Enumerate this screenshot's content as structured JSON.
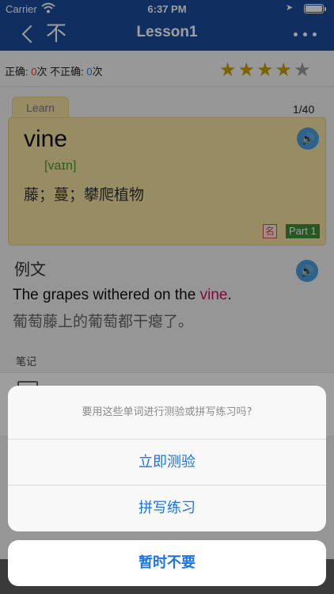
{
  "status_bar": {
    "carrier": "Carrier",
    "time": "6:37 PM"
  },
  "nav": {
    "back_icon": "chevron-left-icon",
    "not_label": "不",
    "title": "Lesson1",
    "more_icon": "more-dots-icon"
  },
  "stats": {
    "correct_label": "正确: ",
    "correct_value": "0",
    "correct_unit": "次",
    "incorrect_label": " 不正确: ",
    "incorrect_value": "0",
    "incorrect_unit": "次"
  },
  "rating": {
    "filled": 4,
    "total": 5
  },
  "card": {
    "tab_label": "Learn",
    "progress": "1/40",
    "word": "vine",
    "phonetic": "[vaɪn]",
    "meaning": "藤；蔓；攀爬植物",
    "pos_tag": "名",
    "part_tag": "Part 1"
  },
  "example": {
    "heading": "例文",
    "sentence_before": "The grapes withered on the ",
    "sentence_highlight": "vine",
    "sentence_after": ".",
    "translation": "葡萄藤上的葡萄都干瘪了。"
  },
  "notes": {
    "heading": "笔记"
  },
  "action_sheet": {
    "message": "要用这些单词进行测验或拼写练习吗?",
    "option_quiz": "立即测验",
    "option_spelling": "拼写练习",
    "cancel": "暂时不要"
  },
  "colors": {
    "nav_bg": "#1b4d9c",
    "card_bg": "#f6e2a4",
    "accent": "#1a73e8",
    "highlight": "#c2185b"
  }
}
